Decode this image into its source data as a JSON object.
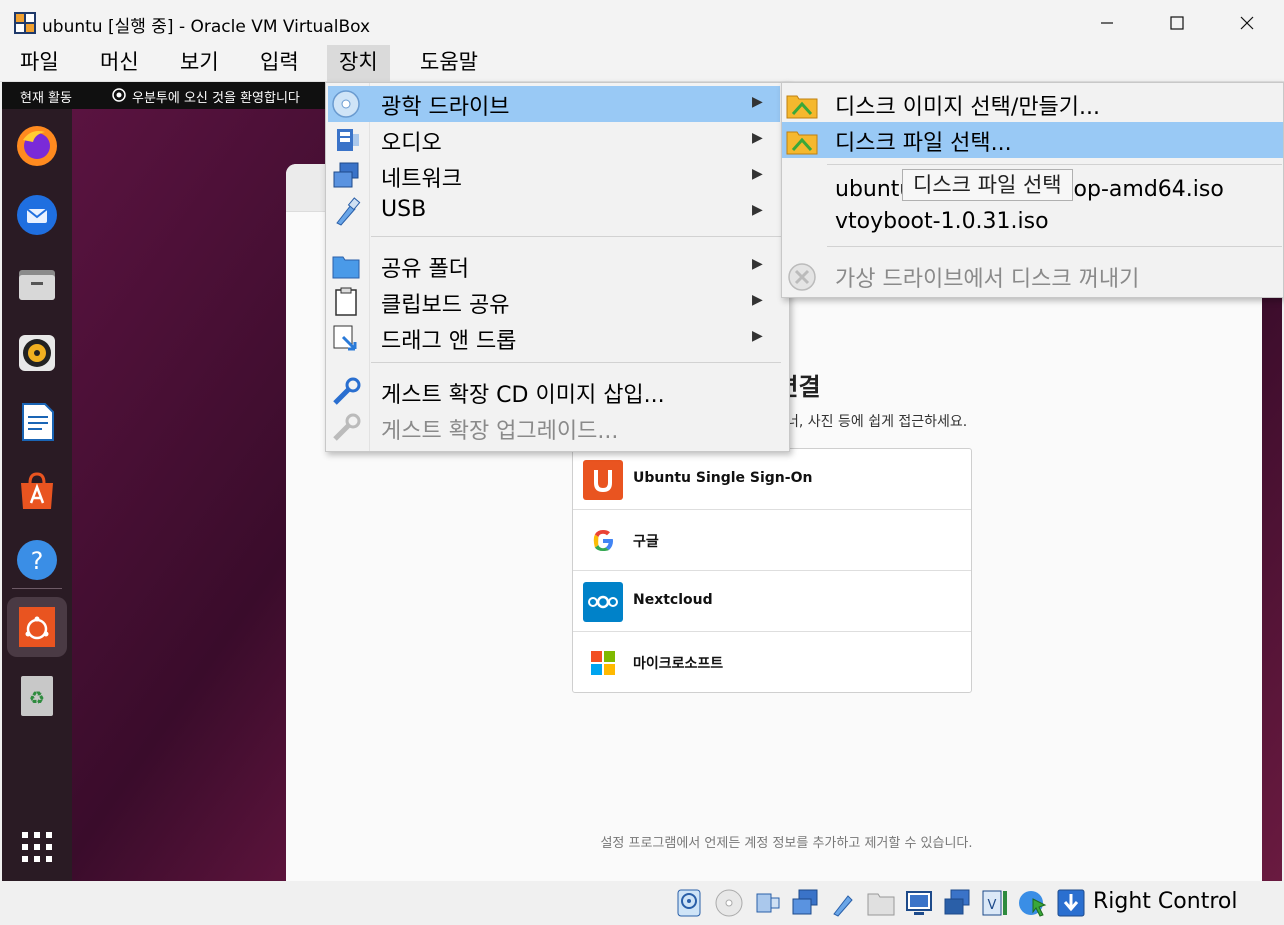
{
  "window": {
    "title": "ubuntu [실행 중] - Oracle VM VirtualBox"
  },
  "menubar": {
    "items": [
      {
        "label": "파일"
      },
      {
        "label": "머신"
      },
      {
        "label": "보기"
      },
      {
        "label": "입력"
      },
      {
        "label": "장치"
      },
      {
        "label": "도움말"
      }
    ],
    "active": "장치"
  },
  "guest": {
    "topbar": {
      "activities": "현재 활동",
      "app_name": "우분투에 오신 것을 환영합니다"
    },
    "dock_icons": [
      "firefox-icon",
      "thunderbird-icon",
      "files-icon",
      "rhythmbox-icon",
      "writer-icon",
      "app-center-icon",
      "help-icon",
      "ubuntu-welcome-icon",
      "trash-icon",
      "show-apps-icon"
    ],
    "welcome": {
      "connect_title": "정 연결",
      "connect_desc": "너, 사진 등에 쉽게 접근하세요.",
      "accounts": [
        {
          "label": "Ubuntu Single Sign-On",
          "icon": "ubuntu-sso-icon"
        },
        {
          "label": "구글",
          "icon": "google-icon"
        },
        {
          "label": "Nextcloud",
          "icon": "nextcloud-icon"
        },
        {
          "label": "마이크로소프트",
          "icon": "microsoft-icon"
        }
      ],
      "footer": "설정 프로그램에서 언제든 계정 정보를 추가하고 제거할 수 있습니다."
    }
  },
  "device_menu": {
    "items": [
      {
        "label": "광학 드라이브",
        "icon": "optical-drive-icon",
        "submenu": true,
        "highlight": true,
        "disabled": false
      },
      {
        "label": "오디오",
        "icon": "audio-icon",
        "submenu": true,
        "disabled": false
      },
      {
        "label": "네트워크",
        "icon": "network-icon",
        "submenu": true,
        "disabled": false
      },
      {
        "label": "USB",
        "icon": "usb-icon",
        "submenu": true,
        "disabled": false
      },
      {
        "label": "공유 폴더",
        "icon": "shared-folder-icon",
        "submenu": true,
        "disabled": false
      },
      {
        "label": "클립보드 공유",
        "icon": "clipboard-icon",
        "submenu": true,
        "disabled": false
      },
      {
        "label": "드래그 앤 드롭",
        "icon": "drag-drop-icon",
        "submenu": true,
        "disabled": false
      },
      {
        "label": "게스트 확장 CD 이미지 삽입...",
        "icon": "guest-additions-icon",
        "submenu": false,
        "disabled": false
      },
      {
        "label": "게스트 확장 업그레이드...",
        "icon": "guest-upgrade-icon",
        "submenu": false,
        "disabled": true
      }
    ]
  },
  "optical_menu": {
    "items": [
      {
        "label": "디스크 이미지 선택/만들기...",
        "icon": "disk-image-folder-icon"
      },
      {
        "label": "디스크 파일 선택...",
        "icon": "disk-file-folder-icon",
        "highlight": true
      },
      {
        "label": "ubuntu-22.04.1-desktop-amd64.iso"
      },
      {
        "label": "vtoyboot-1.0.31.iso"
      },
      {
        "label": "가상 드라이브에서 디스크 꺼내기",
        "icon": "eject-disk-icon",
        "disabled": true
      }
    ],
    "tooltip": "디스크 파일 선택"
  },
  "statusbar": {
    "icons": [
      "hard-disk-icon",
      "optical-disk-icon",
      "audio-status-icon",
      "network-status-icon",
      "usb-status-icon",
      "shared-folders-icon",
      "display-icon",
      "screen-capture-icon",
      "virtualization-icon",
      "mouse-integration-icon",
      "keyboard-capture-icon"
    ],
    "host_key": "Right Control"
  }
}
